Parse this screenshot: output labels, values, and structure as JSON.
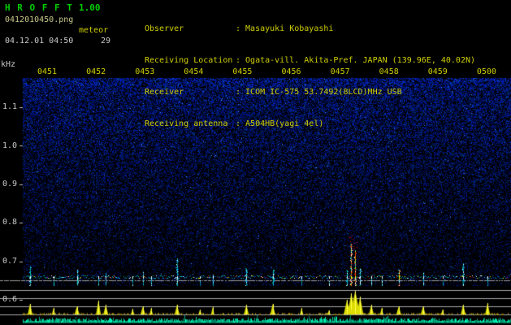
{
  "header": {
    "app_name": "H R O F F T",
    "version": "1.00",
    "filename": "0412010450.png",
    "mode": "meteor",
    "datetime": "04.12.01 04:50",
    "echo_count": "29",
    "info": [
      {
        "label": "Observer",
        "value": ": Masayuki Kobayashi"
      },
      {
        "label": "Receiving Location",
        "value": ": Ogata-vill. Akita-Pref. JAPAN (139.96E, 40.02N)"
      },
      {
        "label": "Receiver",
        "value": ": ICOM IC-575 53.7492(8LCD)MHz USB"
      },
      {
        "label": "Receiving antenna",
        "value": ": A504HB(yagi 4el)"
      }
    ]
  },
  "colors": {
    "title_green": "#00cc00",
    "text_yellow": "#cfcf00",
    "text_white": "#c9c9c9",
    "noise_blue": "#0000c8",
    "spike_yellow": "#dddd00",
    "baseline_cyan": "#00bb88",
    "echo_cyan": "#00cccc",
    "echo_hot": "#dd0000"
  },
  "chart_data": {
    "type": "heatmap",
    "title": "HROFFT radio meteor spectrogram with power plot",
    "x_tick_labels": [
      "0451",
      "0452",
      "0453",
      "0454",
      "0455",
      "0456",
      "0457",
      "0458",
      "0459",
      "0500"
    ],
    "y_unit": "kHz",
    "y_tick_labels": [
      "1.1",
      "1.0",
      "0.9",
      "0.8",
      "0.7",
      "0.6"
    ],
    "y_range_khz": [
      0.55,
      1.15
    ],
    "grid": "horizontal graticule lines in lower power panel",
    "legend_position": "none",
    "echoes": [
      {
        "t": 0.015,
        "streak": 24,
        "power": 13,
        "width": 3,
        "hot": false
      },
      {
        "t": 0.063,
        "streak": 8,
        "power": 8,
        "width": 2,
        "hot": false
      },
      {
        "t": 0.111,
        "streak": 20,
        "power": 10,
        "width": 3,
        "hot": false
      },
      {
        "t": 0.155,
        "streak": 12,
        "power": 17,
        "width": 3,
        "hot": false
      },
      {
        "t": 0.17,
        "streak": 16,
        "power": 12,
        "width": 3,
        "hot": false
      },
      {
        "t": 0.225,
        "streak": 8,
        "power": 7,
        "width": 2,
        "hot": false
      },
      {
        "t": 0.246,
        "streak": 18,
        "power": 10,
        "width": 3,
        "hot": false
      },
      {
        "t": 0.263,
        "streak": 12,
        "power": 8,
        "width": 2,
        "hot": false
      },
      {
        "t": 0.316,
        "streak": 34,
        "power": 12,
        "width": 3,
        "hot": false
      },
      {
        "t": 0.363,
        "streak": 7,
        "power": 6,
        "width": 2,
        "hot": false
      },
      {
        "t": 0.389,
        "streak": 14,
        "power": 9,
        "width": 2,
        "hot": false
      },
      {
        "t": 0.458,
        "streak": 22,
        "power": 12,
        "width": 3,
        "hot": false
      },
      {
        "t": 0.512,
        "streak": 20,
        "power": 13,
        "width": 3,
        "hot": false
      },
      {
        "t": 0.571,
        "streak": 9,
        "power": 8,
        "width": 2,
        "hot": false
      },
      {
        "t": 0.627,
        "streak": 7,
        "power": 5,
        "width": 2,
        "hot": false
      },
      {
        "t": 0.664,
        "streak": 20,
        "power": 18,
        "width": 4,
        "hot": false
      },
      {
        "t": 0.673,
        "streak": 52,
        "power": 26,
        "width": 5,
        "hot": true
      },
      {
        "t": 0.681,
        "streak": 44,
        "power": 29,
        "width": 6,
        "hot": true
      },
      {
        "t": 0.691,
        "streak": 22,
        "power": 22,
        "width": 4,
        "hot": false
      },
      {
        "t": 0.714,
        "streak": 13,
        "power": 12,
        "width": 3,
        "hot": false
      },
      {
        "t": 0.735,
        "streak": 8,
        "power": 8,
        "width": 2,
        "hot": false
      },
      {
        "t": 0.77,
        "streak": 20,
        "power": 10,
        "width": 3,
        "hot": true
      },
      {
        "t": 0.82,
        "streak": 17,
        "power": 10,
        "width": 3,
        "hot": false
      },
      {
        "t": 0.86,
        "streak": 7,
        "power": 6,
        "width": 2,
        "hot": false
      },
      {
        "t": 0.902,
        "streak": 28,
        "power": 12,
        "width": 3,
        "hot": false
      },
      {
        "t": 0.952,
        "streak": 9,
        "power": 14,
        "width": 3,
        "hot": false
      }
    ]
  }
}
